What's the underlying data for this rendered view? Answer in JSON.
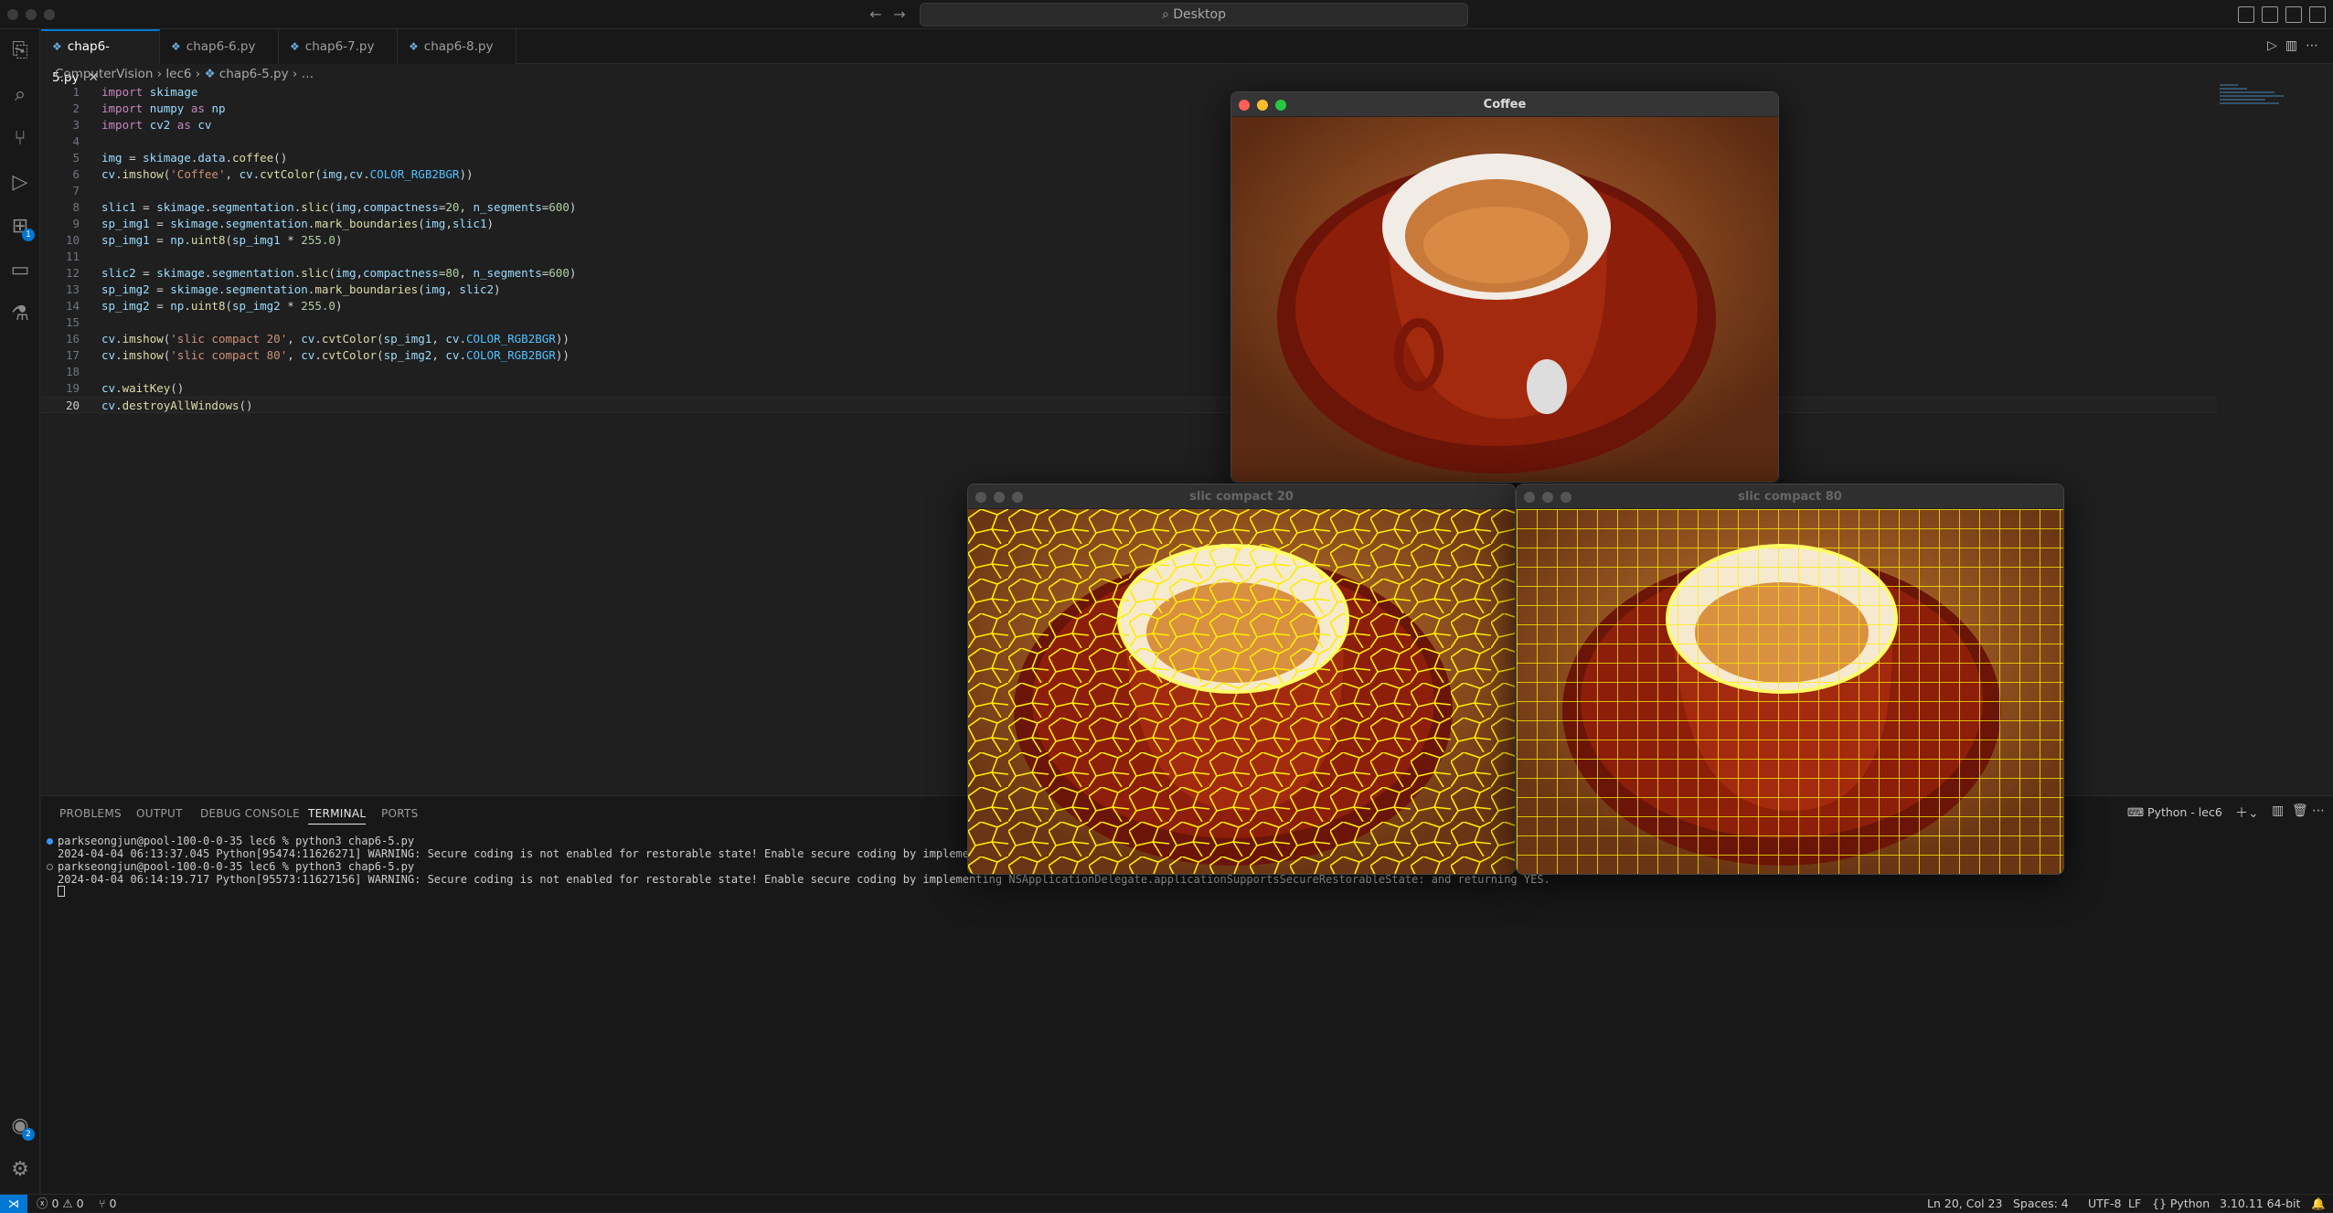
{
  "titlebar": {
    "search_text": "Desktop"
  },
  "tabs": [
    {
      "label": "chap6-5.py",
      "active": true
    },
    {
      "label": "chap6-6.py"
    },
    {
      "label": "chap6-7.py"
    },
    {
      "label": "chap6-8.py"
    }
  ],
  "breadcrumb": {
    "root": "ComputerVision",
    "folder": "lec6",
    "file": "chap6-5.py",
    "rest": "…"
  },
  "editor": {
    "line_numbers": [
      "1",
      "2",
      "3",
      "4",
      "5",
      "6",
      "7",
      "8",
      "9",
      "10",
      "11",
      "12",
      "13",
      "14",
      "15",
      "16",
      "17",
      "18",
      "19",
      "20"
    ],
    "current_line": 20
  },
  "activity_badges": {
    "extensions": "1",
    "accounts": "2"
  },
  "panel": {
    "tabs": [
      "PROBLEMS",
      "OUTPUT",
      "DEBUG CONSOLE",
      "TERMINAL",
      "PORTS"
    ],
    "active_tab": "TERMINAL",
    "terminal_name": "Python - lec6",
    "lines": [
      "parkseongjun@pool-100-0-0-35 lec6 % python3 chap6-5.py",
      "2024-04-04 06:13:37.045 Python[95474:11626271] WARNING: Secure coding is not enabled for restorable state! Enable secure coding by implementin",
      "parkseongjun@pool-100-0-0-35 lec6 % python3 chap6-5.py",
      "2024-04-04 06:14:19.717 Python[95573:11627156] WARNING: Secure coding is not enabled for restorable state! Enable secure coding by implementing NSApplicationDelegate.applicationSupportsSecureRestorableState: and returning YES."
    ]
  },
  "windows": {
    "coffee": "Coffee",
    "slic20": "slic compact 20",
    "slic80": "slic compact 80"
  },
  "status": {
    "errors": "0",
    "warnings": "0",
    "ports": "0",
    "position": "Ln 20, Col 23",
    "spaces": "Spaces: 4",
    "encoding": "UTF-8",
    "eol": "LF",
    "language": "Python",
    "interpreter": "3.10.11 64-bit"
  },
  "colors": {
    "accent": "#0078d4",
    "editor_bg": "#1f1f1f",
    "boundary": "#ffff00"
  }
}
